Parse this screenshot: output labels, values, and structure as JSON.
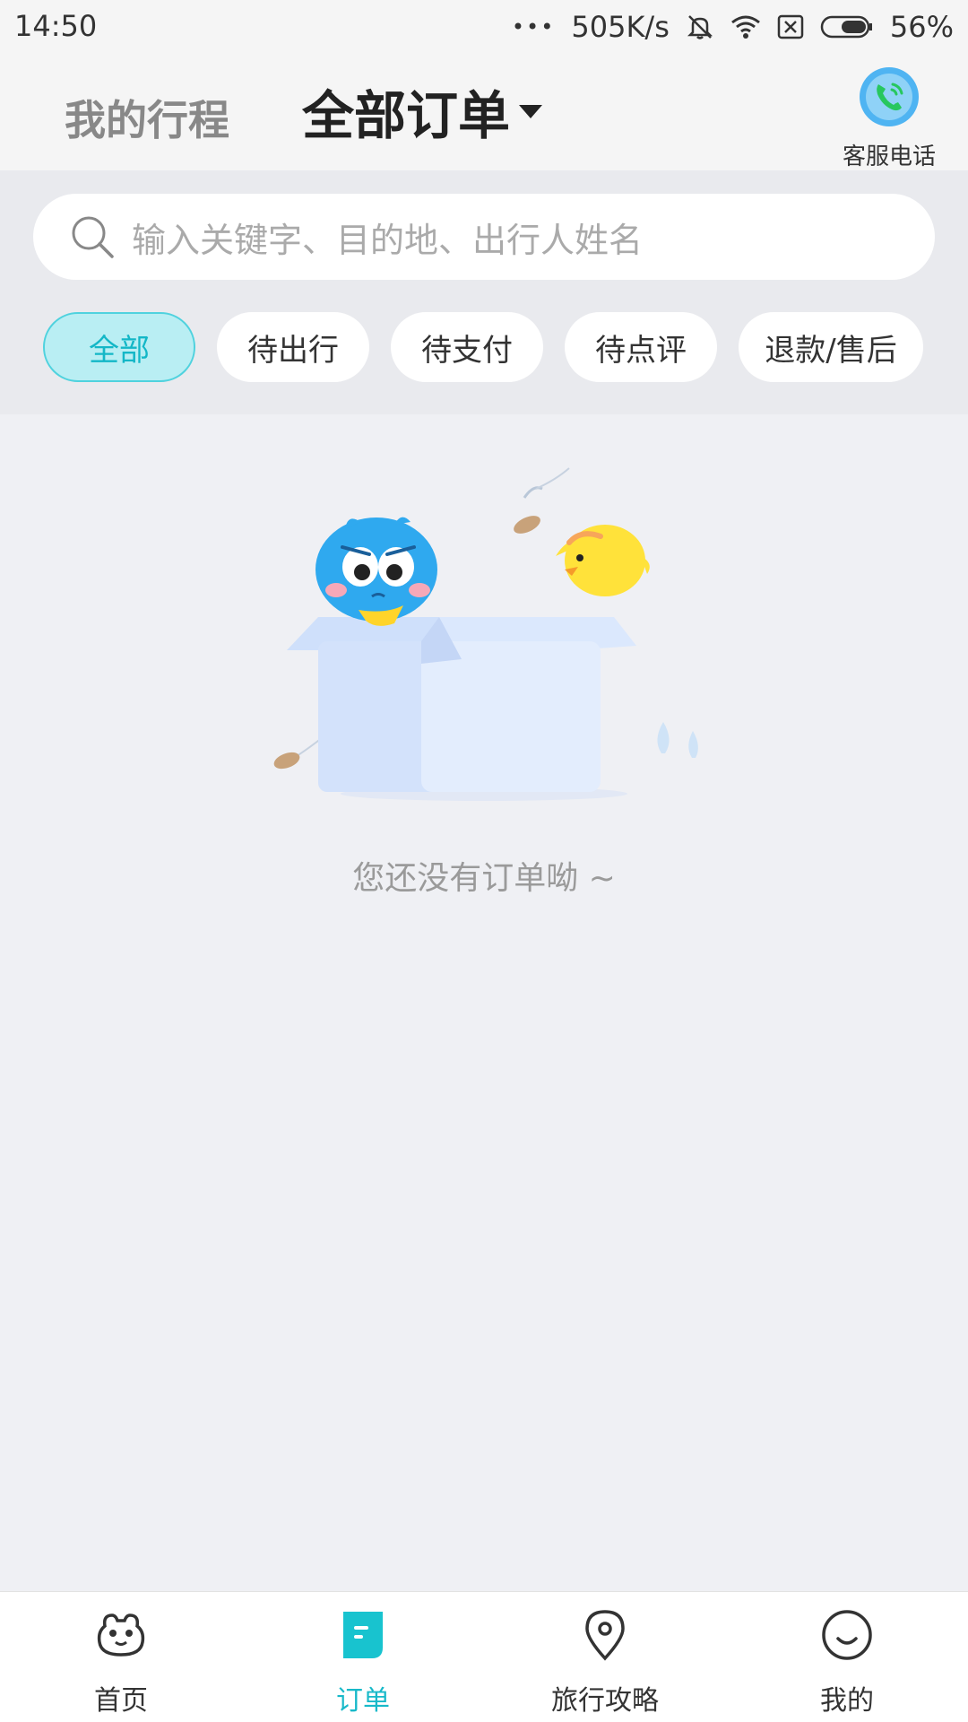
{
  "status_bar": {
    "time": "14:50",
    "more": "•••",
    "net_speed": "505K/s",
    "battery_percent": "56%",
    "icons": [
      "mute-bell-icon",
      "wifi-icon",
      "sim-x-icon",
      "battery-icon"
    ]
  },
  "header": {
    "tab_trips": "我的行程",
    "tab_orders": "全部订单",
    "service_label": "客服电话",
    "colors": {
      "service_icon": "#4fb4f2",
      "service_phone": "#27c75f"
    }
  },
  "search": {
    "placeholder": "输入关键字、目的地、出行人姓名"
  },
  "filters": [
    {
      "label": "全部",
      "active": true
    },
    {
      "label": "待出行",
      "active": false
    },
    {
      "label": "待支付",
      "active": false
    },
    {
      "label": "待点评",
      "active": false
    },
    {
      "label": "退款/售后",
      "active": false
    }
  ],
  "empty_state": {
    "message": "您还没有订单呦 ~",
    "illustration": "empty-box-mascots"
  },
  "bottom_nav": [
    {
      "label": "首页",
      "icon": "home-mascot-icon",
      "active": false
    },
    {
      "label": "订单",
      "icon": "order-icon",
      "active": true
    },
    {
      "label": "旅行攻略",
      "icon": "location-pin-icon",
      "active": false
    },
    {
      "label": "我的",
      "icon": "smile-face-icon",
      "active": false
    }
  ],
  "colors": {
    "accent": "#18b9c9",
    "background": "#eff0f4",
    "chip_active_bg": "#b9eef3"
  }
}
